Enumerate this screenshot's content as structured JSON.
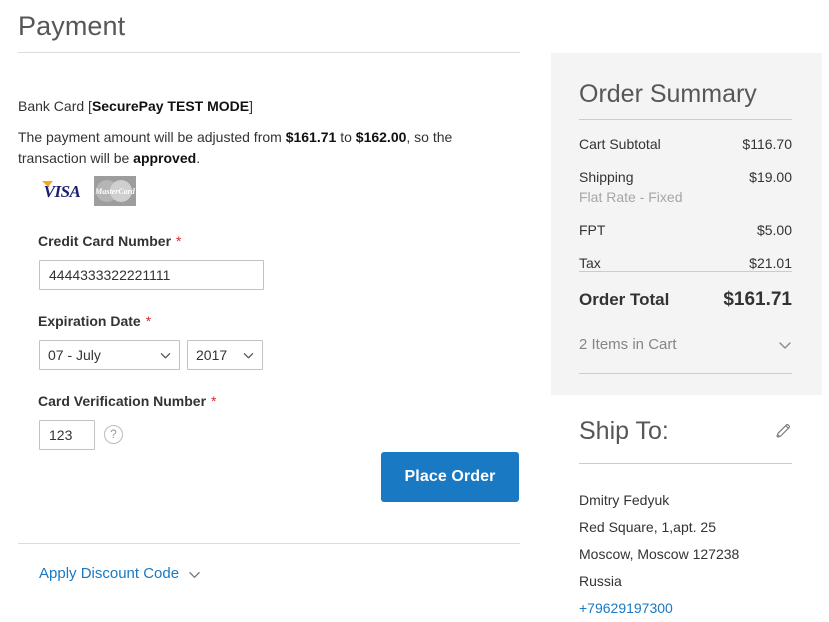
{
  "page": {
    "title": "Payment"
  },
  "payment": {
    "method_prefix": "Bank Card [",
    "method_mode": "SecurePay TEST MODE",
    "method_suffix": "]",
    "note": {
      "part1": "The payment amount will be adjusted from ",
      "amount_from": "$161.71",
      "part2": " to ",
      "amount_to": "$162.00",
      "part3": ", so the transaction will be ",
      "status": "approved",
      "part4": "."
    },
    "accepted_cards": [
      {
        "name": "visa-card-logo",
        "label": "VISA"
      },
      {
        "name": "mastercard-card-logo",
        "label": "MasterCard"
      }
    ],
    "fields": {
      "card_number": {
        "label": "Credit Card Number",
        "required_mark": "*",
        "value": "4444333322221111",
        "placeholder": ""
      },
      "expiration": {
        "label": "Expiration Date",
        "required_mark": "*",
        "month_value": "07 - July",
        "year_value": "2017"
      },
      "cvv": {
        "label": "Card Verification Number",
        "required_mark": "*",
        "value": "123",
        "placeholder": "",
        "help_glyph": "?"
      }
    },
    "place_order_label": "Place Order",
    "discount_label": "Apply Discount Code"
  },
  "summary": {
    "title": "Order Summary",
    "rows": [
      {
        "label": "Cart Subtotal",
        "value": "$116.70"
      },
      {
        "label": "Shipping",
        "value": "$19.00",
        "sublabel": "Flat Rate - Fixed"
      },
      {
        "label": "FPT",
        "value": "$5.00"
      },
      {
        "label": "Tax",
        "value": "$21.01"
      }
    ],
    "total": {
      "label": "Order Total",
      "value": "$161.71"
    },
    "items_toggle_label": "2 Items in Cart"
  },
  "ship_to": {
    "title": "Ship To:",
    "edit_icon_name": "pencil-icon",
    "name": "Dmitry Fedyuk",
    "street": "Red Square, 1,apt. 25",
    "city_state_zip": "Moscow, Moscow 127238",
    "country": "Russia",
    "phone": "+79629197300"
  },
  "colors": {
    "accent": "#1979c3",
    "panel_bg": "#f4f4f4",
    "heading": "#575757",
    "text": "#333333",
    "muted": "#a6a6a6",
    "required": "#e02b27",
    "border": "#c2c2c2",
    "rule": "#dcdcdc"
  }
}
